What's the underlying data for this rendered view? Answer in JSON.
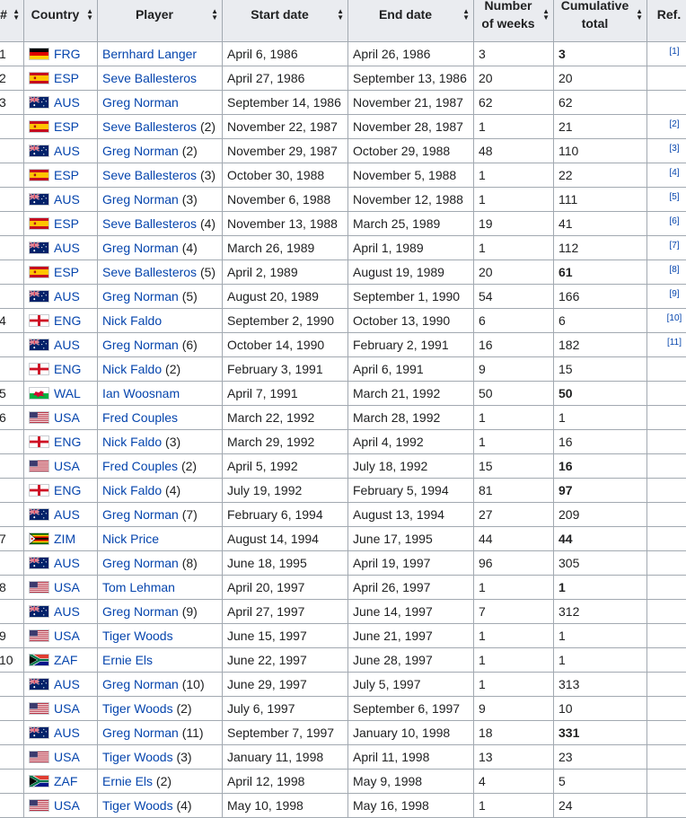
{
  "headers": [
    {
      "key": "num",
      "label": "#"
    },
    {
      "key": "country",
      "label": "Country"
    },
    {
      "key": "player",
      "label": "Player"
    },
    {
      "key": "start",
      "label": "Start date"
    },
    {
      "key": "end",
      "label": "End date"
    },
    {
      "key": "weeks",
      "label": "Number of weeks"
    },
    {
      "key": "cumulative",
      "label": "Cumulative total"
    },
    {
      "key": "ref",
      "label": "Ref."
    }
  ],
  "flag_icons": {
    "FRG": "flag-west-germany-icon",
    "ESP": "flag-spain-icon",
    "AUS": "flag-australia-icon",
    "ENG": "flag-england-icon",
    "WAL": "flag-wales-icon",
    "USA": "flag-usa-icon",
    "ZIM": "flag-zimbabwe-icon",
    "ZAF": "flag-south-africa-icon"
  },
  "link_color": "#0645ad",
  "rows": [
    {
      "num": "1",
      "country": "FRG",
      "player": "Bernhard Langer",
      "count": "",
      "start": "April 6, 1986",
      "end": "April 26, 1986",
      "weeks": "3",
      "cumulative": "3",
      "bold": true,
      "ref": "[1]"
    },
    {
      "num": "2",
      "country": "ESP",
      "player": "Seve Ballesteros",
      "count": "",
      "start": "April 27, 1986",
      "end": "September 13, 1986",
      "weeks": "20",
      "cumulative": "20",
      "bold": false,
      "ref": ""
    },
    {
      "num": "3",
      "country": "AUS",
      "player": "Greg Norman",
      "count": "",
      "start": "September 14, 1986",
      "end": "November 21, 1987",
      "weeks": "62",
      "cumulative": "62",
      "bold": false,
      "ref": ""
    },
    {
      "num": "",
      "country": "ESP",
      "player": "Seve Ballesteros",
      "count": "(2)",
      "start": "November 22, 1987",
      "end": "November 28, 1987",
      "weeks": "1",
      "cumulative": "21",
      "bold": false,
      "ref": "[2]"
    },
    {
      "num": "",
      "country": "AUS",
      "player": "Greg Norman",
      "count": "(2)",
      "start": "November 29, 1987",
      "end": "October 29, 1988",
      "weeks": "48",
      "cumulative": "110",
      "bold": false,
      "ref": "[3]"
    },
    {
      "num": "",
      "country": "ESP",
      "player": "Seve Ballesteros",
      "count": "(3)",
      "start": "October 30, 1988",
      "end": "November 5, 1988",
      "weeks": "1",
      "cumulative": "22",
      "bold": false,
      "ref": "[4]"
    },
    {
      "num": "",
      "country": "AUS",
      "player": "Greg Norman",
      "count": "(3)",
      "start": "November 6, 1988",
      "end": "November 12, 1988",
      "weeks": "1",
      "cumulative": "111",
      "bold": false,
      "ref": "[5]"
    },
    {
      "num": "",
      "country": "ESP",
      "player": "Seve Ballesteros",
      "count": "(4)",
      "start": "November 13, 1988",
      "end": "March 25, 1989",
      "weeks": "19",
      "cumulative": "41",
      "bold": false,
      "ref": "[6]"
    },
    {
      "num": "",
      "country": "AUS",
      "player": "Greg Norman",
      "count": "(4)",
      "start": "March 26, 1989",
      "end": "April 1, 1989",
      "weeks": "1",
      "cumulative": "112",
      "bold": false,
      "ref": "[7]"
    },
    {
      "num": "",
      "country": "ESP",
      "player": "Seve Ballesteros",
      "count": "(5)",
      "start": "April 2, 1989",
      "end": "August 19, 1989",
      "weeks": "20",
      "cumulative": "61",
      "bold": true,
      "ref": "[8]"
    },
    {
      "num": "",
      "country": "AUS",
      "player": "Greg Norman",
      "count": "(5)",
      "start": "August 20, 1989",
      "end": "September 1, 1990",
      "weeks": "54",
      "cumulative": "166",
      "bold": false,
      "ref": "[9]"
    },
    {
      "num": "4",
      "country": "ENG",
      "player": "Nick Faldo",
      "count": "",
      "start": "September 2, 1990",
      "end": "October 13, 1990",
      "weeks": "6",
      "cumulative": "6",
      "bold": false,
      "ref": "[10]"
    },
    {
      "num": "",
      "country": "AUS",
      "player": "Greg Norman",
      "count": "(6)",
      "start": "October 14, 1990",
      "end": "February 2, 1991",
      "weeks": "16",
      "cumulative": "182",
      "bold": false,
      "ref": "[11]"
    },
    {
      "num": "",
      "country": "ENG",
      "player": "Nick Faldo",
      "count": "(2)",
      "start": "February 3, 1991",
      "end": "April 6, 1991",
      "weeks": "9",
      "cumulative": "15",
      "bold": false,
      "ref": ""
    },
    {
      "num": "5",
      "country": "WAL",
      "player": "Ian Woosnam",
      "count": "",
      "start": "April 7, 1991",
      "end": "March 21, 1992",
      "weeks": "50",
      "cumulative": "50",
      "bold": true,
      "ref": ""
    },
    {
      "num": "6",
      "country": "USA",
      "player": "Fred Couples",
      "count": "",
      "start": "March 22, 1992",
      "end": "March 28, 1992",
      "weeks": "1",
      "cumulative": "1",
      "bold": false,
      "ref": ""
    },
    {
      "num": "",
      "country": "ENG",
      "player": "Nick Faldo",
      "count": "(3)",
      "start": "March 29, 1992",
      "end": "April 4, 1992",
      "weeks": "1",
      "cumulative": "16",
      "bold": false,
      "ref": ""
    },
    {
      "num": "",
      "country": "USA",
      "player": "Fred Couples",
      "count": "(2)",
      "start": "April 5, 1992",
      "end": "July 18, 1992",
      "weeks": "15",
      "cumulative": "16",
      "bold": true,
      "ref": ""
    },
    {
      "num": "",
      "country": "ENG",
      "player": "Nick Faldo",
      "count": "(4)",
      "start": "July 19, 1992",
      "end": "February 5, 1994",
      "weeks": "81",
      "cumulative": "97",
      "bold": true,
      "ref": ""
    },
    {
      "num": "",
      "country": "AUS",
      "player": "Greg Norman",
      "count": "(7)",
      "start": "February 6, 1994",
      "end": "August 13, 1994",
      "weeks": "27",
      "cumulative": "209",
      "bold": false,
      "ref": ""
    },
    {
      "num": "7",
      "country": "ZIM",
      "player": "Nick Price",
      "count": "",
      "start": "August 14, 1994",
      "end": "June 17, 1995",
      "weeks": "44",
      "cumulative": "44",
      "bold": true,
      "ref": ""
    },
    {
      "num": "",
      "country": "AUS",
      "player": "Greg Norman",
      "count": "(8)",
      "start": "June 18, 1995",
      "end": "April 19, 1997",
      "weeks": "96",
      "cumulative": "305",
      "bold": false,
      "ref": ""
    },
    {
      "num": "8",
      "country": "USA",
      "player": "Tom Lehman",
      "count": "",
      "start": "April 20, 1997",
      "end": "April 26, 1997",
      "weeks": "1",
      "cumulative": "1",
      "bold": true,
      "ref": ""
    },
    {
      "num": "",
      "country": "AUS",
      "player": "Greg Norman",
      "count": "(9)",
      "start": "April 27, 1997",
      "end": "June 14, 1997",
      "weeks": "7",
      "cumulative": "312",
      "bold": false,
      "ref": ""
    },
    {
      "num": "9",
      "country": "USA",
      "player": "Tiger Woods",
      "count": "",
      "start": "June 15, 1997",
      "end": "June 21, 1997",
      "weeks": "1",
      "cumulative": "1",
      "bold": false,
      "ref": ""
    },
    {
      "num": "10",
      "country": "ZAF",
      "player": "Ernie Els",
      "count": "",
      "start": "June 22, 1997",
      "end": "June 28, 1997",
      "weeks": "1",
      "cumulative": "1",
      "bold": false,
      "ref": ""
    },
    {
      "num": "",
      "country": "AUS",
      "player": "Greg Norman",
      "count": "(10)",
      "start": "June 29, 1997",
      "end": "July 5, 1997",
      "weeks": "1",
      "cumulative": "313",
      "bold": false,
      "ref": ""
    },
    {
      "num": "",
      "country": "USA",
      "player": "Tiger Woods",
      "count": "(2)",
      "start": "July 6, 1997",
      "end": "September 6, 1997",
      "weeks": "9",
      "cumulative": "10",
      "bold": false,
      "ref": ""
    },
    {
      "num": "",
      "country": "AUS",
      "player": "Greg Norman",
      "count": "(11)",
      "start": "September 7, 1997",
      "end": "January 10, 1998",
      "weeks": "18",
      "cumulative": "331",
      "bold": true,
      "ref": ""
    },
    {
      "num": "",
      "country": "USA",
      "player": "Tiger Woods",
      "count": "(3)",
      "start": "January 11, 1998",
      "end": "April 11, 1998",
      "weeks": "13",
      "cumulative": "23",
      "bold": false,
      "ref": ""
    },
    {
      "num": "",
      "country": "ZAF",
      "player": "Ernie Els",
      "count": "(2)",
      "start": "April 12, 1998",
      "end": "May 9, 1998",
      "weeks": "4",
      "cumulative": "5",
      "bold": false,
      "ref": ""
    },
    {
      "num": "",
      "country": "USA",
      "player": "Tiger Woods",
      "count": "(4)",
      "start": "May 10, 1998",
      "end": "May 16, 1998",
      "weeks": "1",
      "cumulative": "24",
      "bold": false,
      "ref": ""
    }
  ]
}
